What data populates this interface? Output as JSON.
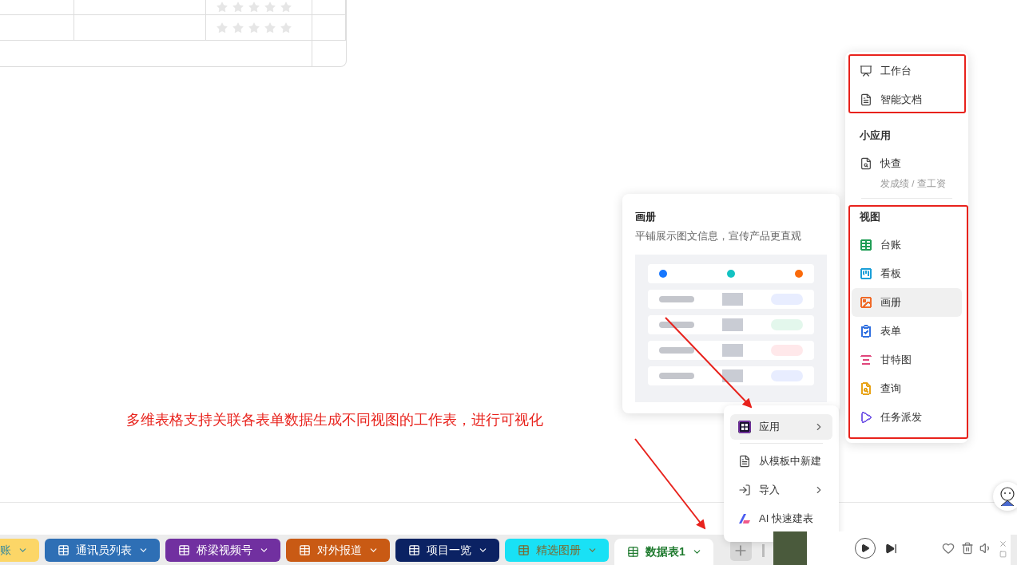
{
  "table": {
    "rating_rows": [
      {
        "stars": 0
      },
      {
        "stars": 0
      }
    ]
  },
  "annotation": {
    "text": "多维表格支持关联各表单数据生成不同视图的工作表，进行可视化"
  },
  "preview": {
    "title": "画册",
    "description": "平铺展示图文信息，宣传产品更直观"
  },
  "add_menu": {
    "items": [
      {
        "kind": "apps",
        "label": "应用",
        "submenu": true,
        "selected": true
      },
      {
        "kind": "template",
        "label": "从模板中新建",
        "submenu": false,
        "selected": false
      },
      {
        "kind": "import",
        "label": "导入",
        "submenu": true,
        "selected": false
      },
      {
        "kind": "ai",
        "label": "AI 快速建表",
        "submenu": false,
        "selected": false
      }
    ]
  },
  "side_menu": {
    "sections": [
      {
        "items": [
          {
            "kind": "workbench",
            "label": "工作台",
            "selected": false
          },
          {
            "kind": "doc",
            "label": "智能文档",
            "selected": false
          }
        ]
      },
      {
        "heading": "小应用",
        "items": [
          {
            "kind": "quick",
            "label": "快查",
            "sublabel": "发成绩 / 查工资",
            "selected": false
          }
        ]
      },
      {
        "heading": "视图",
        "items": [
          {
            "kind": "ledger",
            "label": "台账",
            "color": "#1f9d55",
            "selected": false
          },
          {
            "kind": "kanban",
            "label": "看板",
            "color": "#1a9fd8",
            "selected": false
          },
          {
            "kind": "gallery",
            "label": "画册",
            "color": "#f06a28",
            "selected": true
          },
          {
            "kind": "form",
            "label": "表单",
            "color": "#2f6fe0",
            "selected": false
          },
          {
            "kind": "gantt",
            "label": "甘特图",
            "color": "#e0457b",
            "selected": false
          },
          {
            "kind": "query",
            "label": "查询",
            "color": "#e8a317",
            "selected": false
          },
          {
            "kind": "task",
            "label": "任务派发",
            "color": "#7b61e8",
            "selected": false
          }
        ]
      }
    ]
  },
  "sheet_tabs": [
    {
      "label": "账",
      "color": "#fcd667",
      "selected": false
    },
    {
      "label": "通讯员列表",
      "color": "#2e6fb5",
      "selected": false
    },
    {
      "label": "桥梁视频号",
      "color": "#7130a0",
      "selected": false
    },
    {
      "label": "对外报道",
      "color": "#c95a14",
      "selected": false
    },
    {
      "label": "项目一览",
      "color": "#0b2263",
      "selected": false
    },
    {
      "label": "精选图册",
      "color": "#19e1f5",
      "selected": false
    },
    {
      "label": "数据表1",
      "color": "#ffffff",
      "selected": true
    }
  ]
}
